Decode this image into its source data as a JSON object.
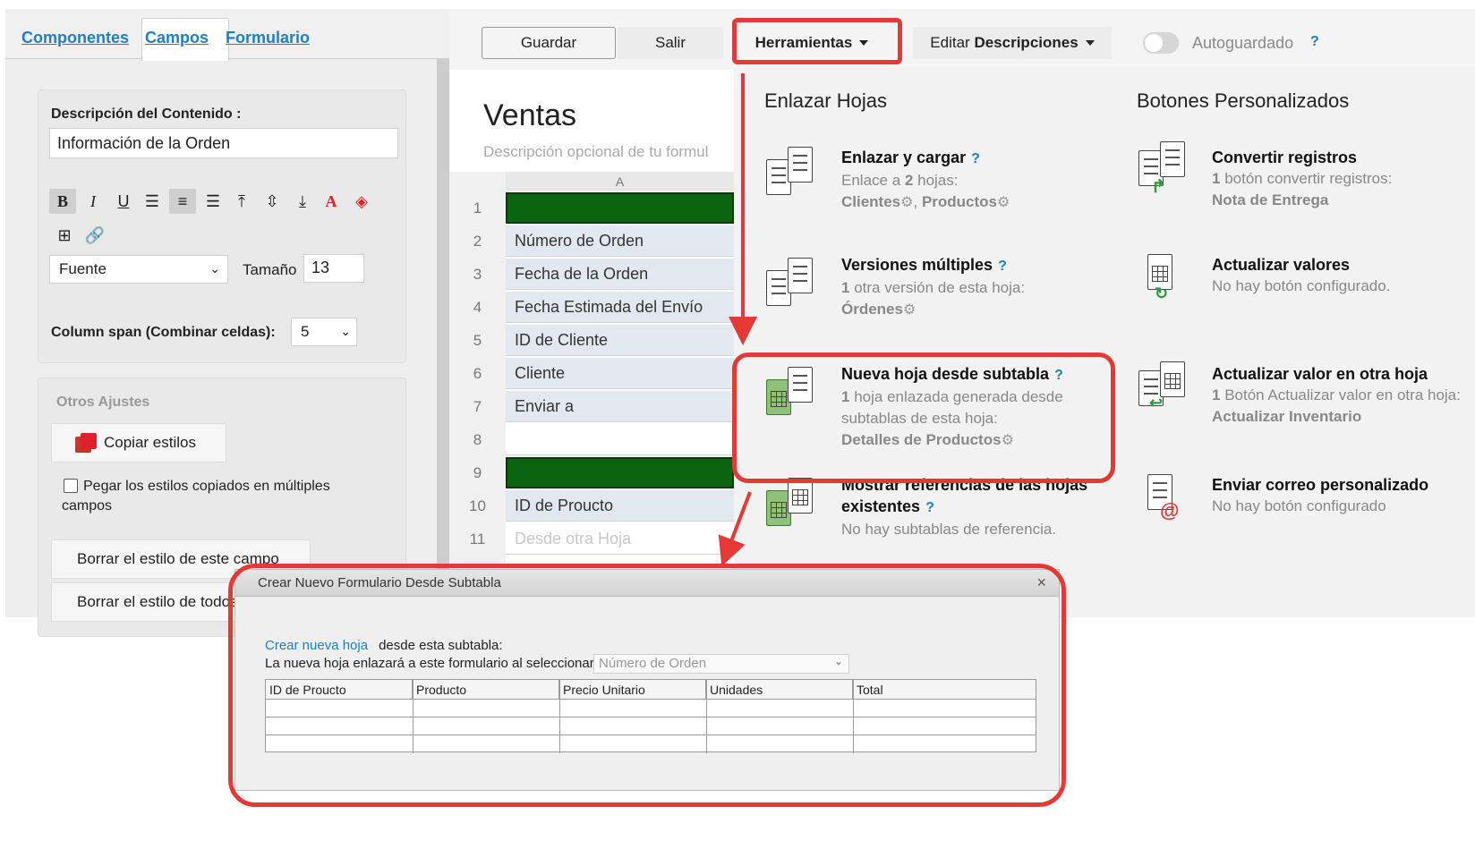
{
  "left_tabs": [
    "Componentes",
    "Campos",
    "Formulario"
  ],
  "content_desc": {
    "label": "Descripción del Contenido :",
    "value": "Información de la Orden",
    "font_select": "Fuente",
    "size_label": "Tamaño",
    "size_value": "13",
    "span_label": "Column span (Combinar celdas):",
    "span_value": "5"
  },
  "other_settings": {
    "title": "Otros Ajustes",
    "copy_styles": "Copiar estilos",
    "paste_label": "Pegar los estilos copiados en múltiples campos",
    "clear_field": "Borrar el estilo de este campo",
    "clear_all": "Borrar el estilo de todos"
  },
  "toolbar": {
    "save": "Guardar",
    "exit": "Salir",
    "tools": "Herramientas",
    "edit_prefix": "Editar",
    "edit_strong": "Descripciones",
    "autosave": "Autoguardado",
    "help": "?"
  },
  "sheet": {
    "title": "Ventas",
    "description": "Descripción opcional de tu formul",
    "column": "A",
    "rows": [
      {
        "num": "1",
        "text": "",
        "type": "green"
      },
      {
        "num": "2",
        "text": "Número de Orden",
        "type": "field"
      },
      {
        "num": "3",
        "text": "Fecha de la Orden",
        "type": "field"
      },
      {
        "num": "4",
        "text": "Fecha Estimada del Envío",
        "type": "field"
      },
      {
        "num": "5",
        "text": "ID de Cliente",
        "type": "field"
      },
      {
        "num": "6",
        "text": "Cliente",
        "type": "field"
      },
      {
        "num": "7",
        "text": "Enviar a",
        "type": "field"
      },
      {
        "num": "8",
        "text": "",
        "type": "blank"
      },
      {
        "num": "9",
        "text": "",
        "type": "green"
      },
      {
        "num": "10",
        "text": "ID de Proucto",
        "type": "field"
      },
      {
        "num": "11",
        "text": "Desde otra Hoja",
        "type": "faded"
      }
    ]
  },
  "tools_menu": {
    "link_sheets_title": "Enlazar Hojas",
    "custom_buttons_title": "Botones Personalizados",
    "link_upload": {
      "title": "Enlazar y cargar",
      "desc_pre": "Enlace a",
      "count": "2",
      "desc_post": "hojas:",
      "links": [
        "Clientes",
        "Productos"
      ]
    },
    "multi_versions": {
      "title": "Versiones múltiples",
      "count": "1",
      "desc": "otra versión de esta hoja:",
      "link": "Órdenes"
    },
    "new_from_subtable": {
      "title": "Nueva hoja desde subtabla",
      "count": "1",
      "desc": "hoja enlazada generada desde subtablas de esta hoja:",
      "link": "Detalles de Productos"
    },
    "show_refs": {
      "title": "Mostrar referencias de las hojas existentes",
      "desc": "No hay subtablas de referencia."
    },
    "convert_records": {
      "title": "Convertir registros",
      "count": "1",
      "desc": "botón convertir registros:",
      "link": "Nota de Entrega"
    },
    "update_values": {
      "title": "Actualizar valores",
      "desc": "No hay botón configurado."
    },
    "update_other": {
      "title": "Actualizar valor en otra hoja",
      "count": "1",
      "desc": "Botón Actualizar valor en otra hoja:",
      "link": "Actualizar Inventario"
    },
    "custom_email": {
      "title": "Enviar correo personalizado",
      "desc": "No hay botón configurado"
    }
  },
  "modal": {
    "title": "Crear Nuevo Formulario Desde Subtabla",
    "close": "×",
    "link": "Crear nueva hoja",
    "line1": "desde esta subtabla:",
    "line2": "La nueva hoja enlazará a este formulario al seleccionar:",
    "select_value": "Número de Orden",
    "columns": [
      "ID de Proucto",
      "Producto",
      "Precio Unitario",
      "Unidades",
      "Total"
    ]
  },
  "colors": {
    "accent": "#1c7fc7",
    "highlight": "#e53935",
    "green_row": "#0a6410"
  }
}
